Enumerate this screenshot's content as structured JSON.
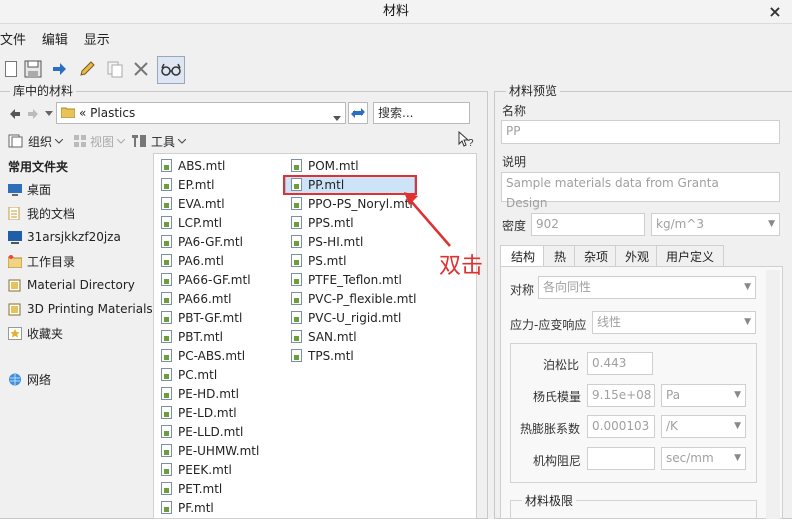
{
  "window": {
    "title": "材料",
    "close_glyph": "×"
  },
  "menu": [
    "文件",
    "编辑",
    "显示"
  ],
  "toolbar": {
    "icons": [
      "new-file-icon",
      "save-icon",
      "arrow-right-icon",
      "pencil-icon",
      "copy-icon",
      "delete-icon",
      "glasses-icon"
    ]
  },
  "library": {
    "group_label": "库中的材料",
    "path": "« Plastics",
    "search_placeholder": "搜索...",
    "organize": "组织",
    "view": "视图",
    "tools": "工具",
    "help_icon": "help-cursor-icon"
  },
  "sidebar": {
    "heading": "常用文件夹",
    "items": [
      {
        "label": "桌面",
        "icon": "desktop-icon"
      },
      {
        "label": "我的文档",
        "icon": "documents-icon"
      },
      {
        "label": "31arsjkkzf20jza",
        "icon": "computer-icon"
      },
      {
        "label": "工作目录",
        "icon": "work-folder-icon"
      },
      {
        "label": "Material Directory",
        "icon": "folder-icon"
      },
      {
        "label": "3D Printing Materials",
        "icon": "folder-icon"
      },
      {
        "label": "收藏夹",
        "icon": "favorites-icon"
      },
      {
        "label": "网络",
        "icon": "network-icon"
      }
    ]
  },
  "files_col1": [
    "ABS.mtl",
    "EP.mtl",
    "EVA.mtl",
    "LCP.mtl",
    "PA6-GF.mtl",
    "PA6.mtl",
    "PA66-GF.mtl",
    "PA66.mtl",
    "PBT-GF.mtl",
    "PBT.mtl",
    "PC-ABS.mtl",
    "PC.mtl",
    "PE-HD.mtl",
    "PE-LD.mtl",
    "PE-LLD.mtl",
    "PE-UHMW.mtl",
    "PEEK.mtl",
    "PET.mtl",
    "PF.mtl"
  ],
  "files_col2": [
    "POM.mtl",
    "PP.mtl",
    "PPO-PS_Noryl.mtl",
    "PPS.mtl",
    "PS-HI.mtl",
    "PS.mtl",
    "PTFE_Teflon.mtl",
    "PVC-P_flexible.mtl",
    "PVC-U_rigid.mtl",
    "SAN.mtl",
    "TPS.mtl"
  ],
  "selected_file": "PP.mtl",
  "annotation": "双击",
  "preview": {
    "group_label": "材料预览",
    "name_label": "名称",
    "name_value": "PP",
    "desc_label": "说明",
    "desc_value": "Sample materials data from Granta Design",
    "density_label": "密度",
    "density_value": "902",
    "density_unit": "kg/m^3",
    "tabs": [
      "结构",
      "热",
      "杂项",
      "外观",
      "用户定义"
    ],
    "symmetry_label": "对称",
    "symmetry_value": "各向同性",
    "stress_label": "应力-应变响应",
    "stress_value": "线性",
    "poisson_label": "泊松比",
    "poisson_value": "0.443",
    "young_label": "杨氏模量",
    "young_value": "9.15e+08",
    "young_unit": "Pa",
    "thermal_label": "热膨胀系数",
    "thermal_value": "0.000103",
    "thermal_unit": "/K",
    "damping_label": "机构阻尼",
    "damping_value": "",
    "damping_unit": "sec/mm",
    "limits_label": "材料极限"
  }
}
